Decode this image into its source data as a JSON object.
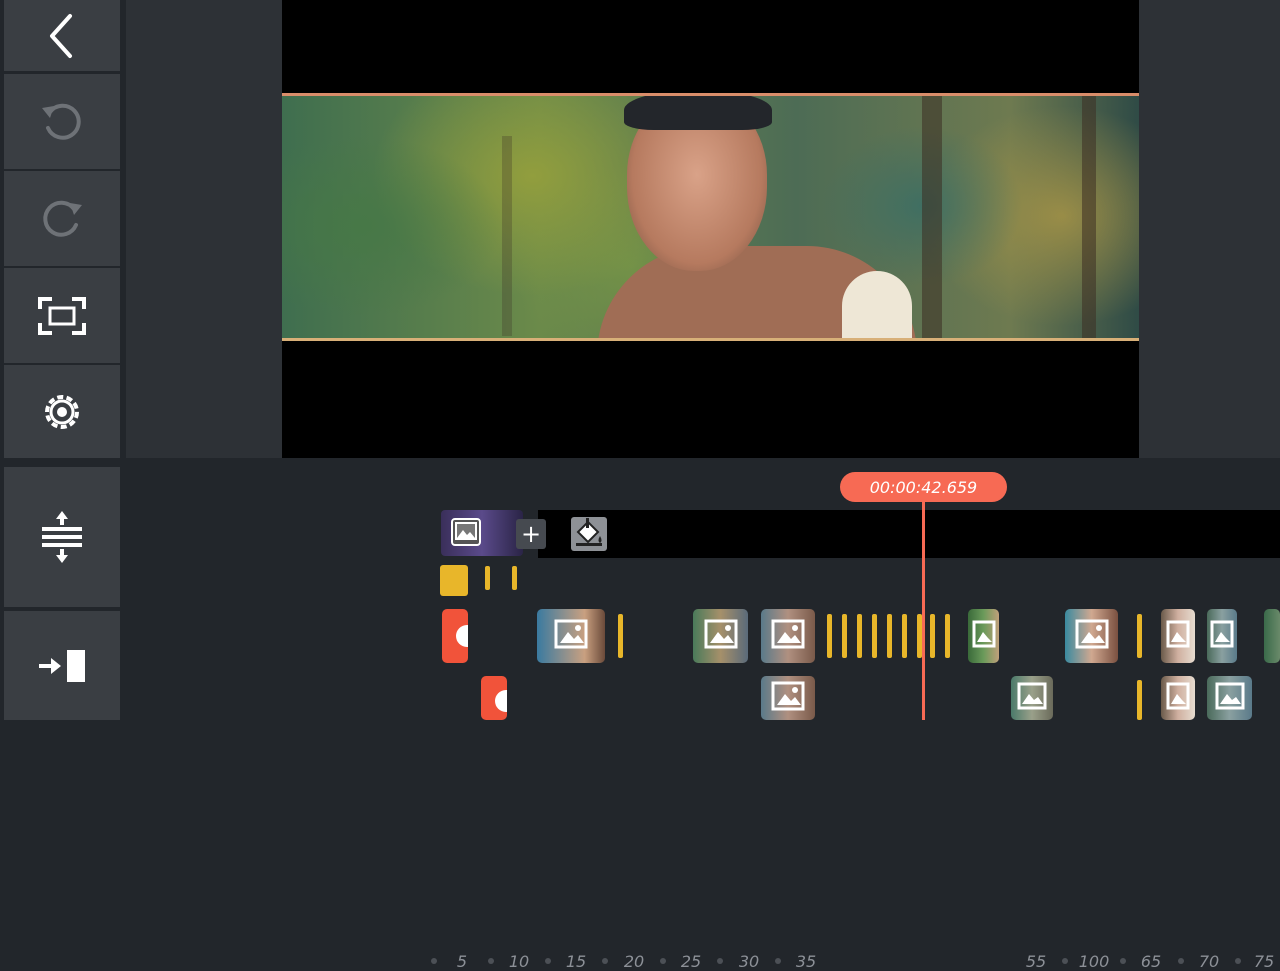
{
  "sidebar": {
    "items": [
      {
        "name": "back-button",
        "icon": "chevron-left-icon"
      },
      {
        "name": "undo-button",
        "icon": "undo-icon"
      },
      {
        "name": "redo-button",
        "icon": "redo-icon"
      },
      {
        "name": "fullscreen-button",
        "icon": "fit-screen-icon"
      },
      {
        "name": "settings-button",
        "icon": "gear-icon"
      },
      {
        "name": "timeline-expand-button",
        "icon": "expand-vertical-icon"
      },
      {
        "name": "export-button",
        "icon": "export-icon"
      }
    ]
  },
  "timeline": {
    "current_time": "00:00:42.659",
    "ruler_labels": [
      "5",
      "10",
      "15",
      "20",
      "25",
      "30",
      "35",
      "55",
      "100",
      "65",
      "70",
      "75"
    ],
    "add_label": "+"
  },
  "colors": {
    "accent": "#f76a54",
    "audio_marker": "#e8b62a",
    "panel": "#3a3e43",
    "background": "#22262b"
  }
}
